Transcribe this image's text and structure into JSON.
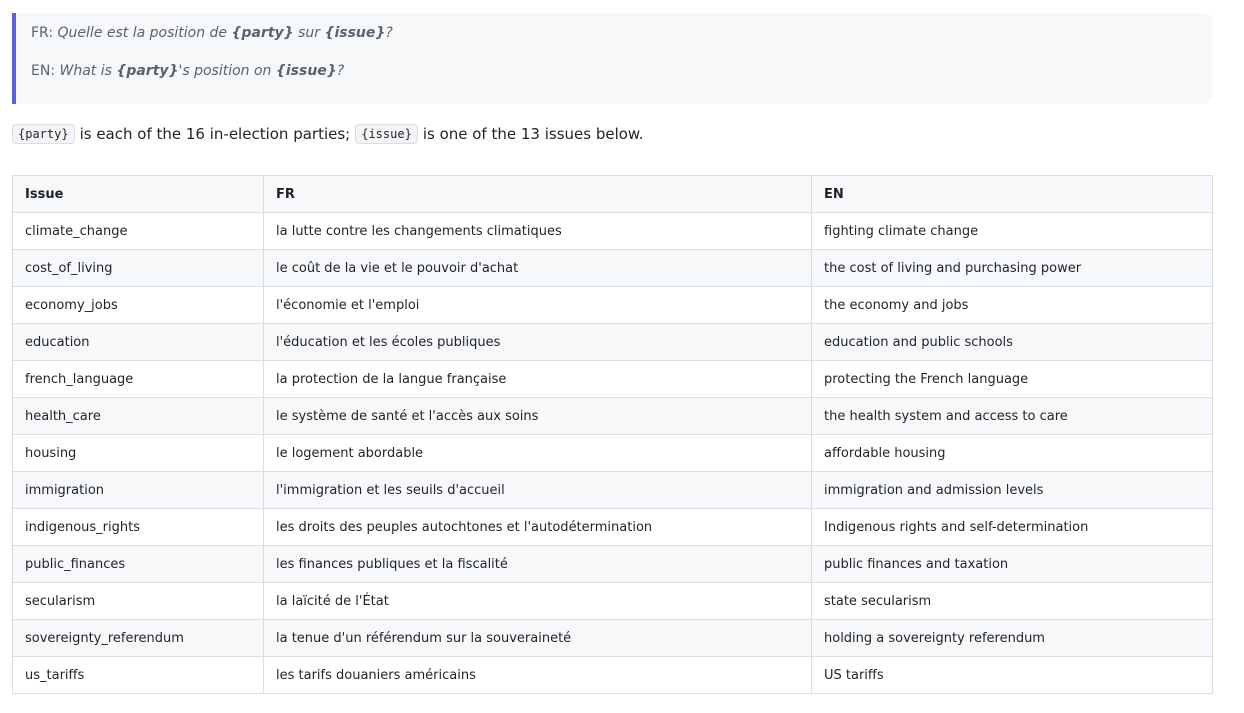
{
  "prompt": {
    "fr": {
      "lang": "FR:",
      "pre": "Quelle est la position de",
      "party": "{party}",
      "mid": "sur",
      "issue": "{issue}",
      "post": "?"
    },
    "en": {
      "lang": "EN:",
      "pre": "What is",
      "party": "{party}",
      "mid": "'s position on",
      "issue": "{issue}",
      "post": "?"
    }
  },
  "intro": {
    "code_party": "{party}",
    "text1": "is each of the 16 in-election parties;",
    "code_issue": "{issue}",
    "text2": "is one of the 13 issues below."
  },
  "table": {
    "headers": [
      "Issue",
      "FR",
      "EN"
    ],
    "rows": [
      [
        "climate_change",
        "la lutte contre les changements climatiques",
        "fighting climate change"
      ],
      [
        "cost_of_living",
        "le coût de la vie et le pouvoir d'achat",
        "the cost of living and purchasing power"
      ],
      [
        "economy_jobs",
        "l'économie et l'emploi",
        "the economy and jobs"
      ],
      [
        "education",
        "l'éducation et les écoles publiques",
        "education and public schools"
      ],
      [
        "french_language",
        "la protection de la langue française",
        "protecting the French language"
      ],
      [
        "health_care",
        "le système de santé et l'accès aux soins",
        "the health system and access to care"
      ],
      [
        "housing",
        "le logement abordable",
        "affordable housing"
      ],
      [
        "immigration",
        "l'immigration et les seuils d'accueil",
        "immigration and admission levels"
      ],
      [
        "indigenous_rights",
        "les droits des peuples autochtones et l'autodétermination",
        "Indigenous rights and self-determination"
      ],
      [
        "public_finances",
        "les finances publiques et la fiscalité",
        "public finances and taxation"
      ],
      [
        "secularism",
        "la laïcité de l'État",
        "state secularism"
      ],
      [
        "sovereignty_referendum",
        "la tenue d'un référendum sur la souveraineté",
        "holding a sovereignty referendum"
      ],
      [
        "us_tariffs",
        "les tarifs douaniers américains",
        "US tariffs"
      ]
    ]
  }
}
